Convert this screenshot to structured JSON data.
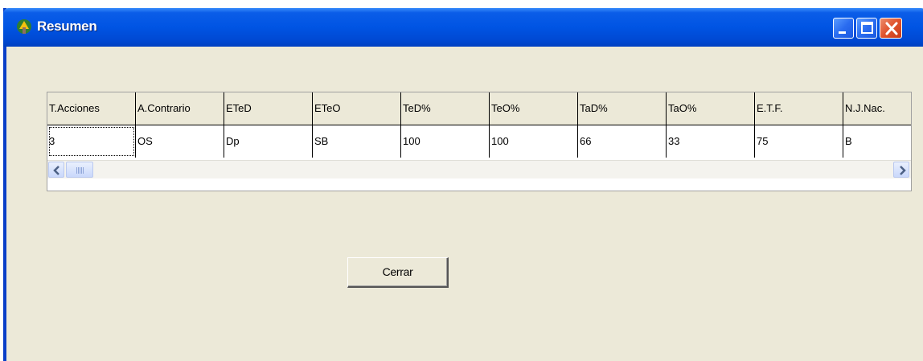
{
  "window": {
    "title": "Resumen",
    "icon": "app-icon",
    "controls": [
      "minimize-icon",
      "maximize-icon",
      "close-icon"
    ]
  },
  "table": {
    "columns": [
      "T.Acciones",
      "A.Contrario",
      "ETeD",
      "ETeO",
      "TeD%",
      "TeO%",
      "TaD%",
      "TaO%",
      "E.T.F.",
      "N.J.Nac."
    ],
    "rows": [
      [
        "3",
        "OS",
        "Dp",
        "SB",
        "100",
        "100",
        "66",
        "33",
        "75",
        "B"
      ]
    ]
  },
  "buttons": {
    "close_label": "Cerrar"
  },
  "colors": {
    "titlebar": "#0054e3",
    "window_bg": "#ece9d8",
    "close_button": "#e0522c"
  }
}
